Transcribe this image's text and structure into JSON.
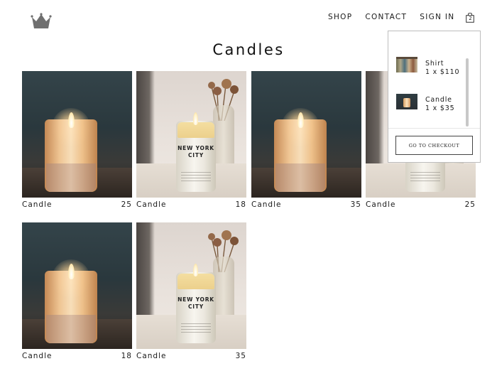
{
  "brand": {
    "logo_icon": "crown-icon"
  },
  "nav": {
    "shop": "SHOP",
    "contact": "CONTACT",
    "sign_in": "SIGN IN",
    "cart_icon": "shopping-bag-icon",
    "cart_count": "2"
  },
  "page": {
    "title": "Candles"
  },
  "products": [
    {
      "name": "Candle",
      "price": "25",
      "image": "glowing-candle"
    },
    {
      "name": "Candle",
      "price": "18",
      "image": "new-york-city-candle"
    },
    {
      "name": "Candle",
      "price": "35",
      "image": "glowing-candle"
    },
    {
      "name": "Candle",
      "price": "25",
      "image": "new-york-city-candle"
    },
    {
      "name": "Candle",
      "price": "18",
      "image": "glowing-candle"
    },
    {
      "name": "Candle",
      "price": "35",
      "image": "new-york-city-candle"
    }
  ],
  "product_image_text": {
    "nyc_label": "NEW YORK CITY"
  },
  "cart": {
    "items": [
      {
        "name": "Shirt",
        "qty_price": "1 x $110"
      },
      {
        "name": "Candle",
        "qty_price": "1 x $35"
      }
    ],
    "checkout_label": "GO TO CHECKOUT"
  }
}
